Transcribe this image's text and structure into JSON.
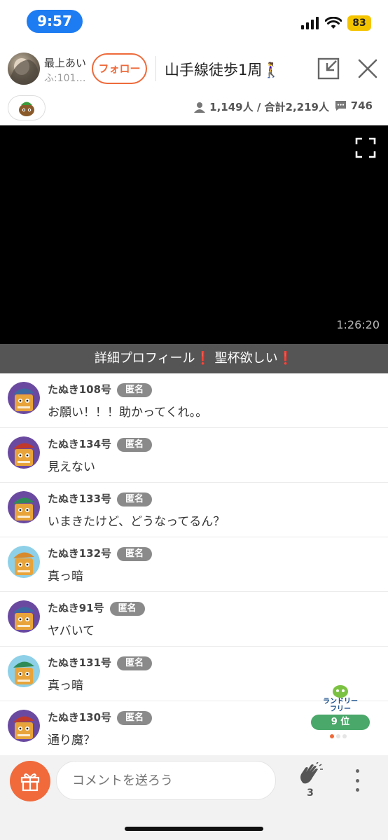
{
  "status_bar": {
    "time": "9:57",
    "battery": "83"
  },
  "header": {
    "host_name": "最上あい",
    "host_sub": "ふ:101…",
    "follow_label": "フォロー",
    "title": "山手線徒歩1周🚶‍♀️"
  },
  "stats": {
    "viewers": "1,149人 / 合計2,219人",
    "comments": "746"
  },
  "video": {
    "elapsed": "1:26:20"
  },
  "banner": {
    "text": "詳細プロフィール",
    "excl1": "❗",
    "text2": " 聖杯欲しい",
    "excl2": "❗"
  },
  "comments": [
    {
      "name": "たぬき108号",
      "badge": "匿名",
      "text": "お願い！！！助かってくれ。。",
      "hat": "#3b6aa0"
    },
    {
      "name": "たぬき134号",
      "badge": "匿名",
      "text": "見えない",
      "hat": "#c0392b"
    },
    {
      "name": "たぬき133号",
      "badge": "匿名",
      "text": "いまきたけど、どうなってるん？",
      "hat": "#2e8b57"
    },
    {
      "name": "たぬき132号",
      "badge": "匿名",
      "text": "真っ暗",
      "hat": "#d98a2b"
    },
    {
      "name": "たぬき91号",
      "badge": "匿名",
      "text": "ヤバいて",
      "hat": "#3b6aa0"
    },
    {
      "name": "たぬき131号",
      "badge": "匿名",
      "text": "真っ暗",
      "hat": "#2e8b57"
    },
    {
      "name": "たぬき130号",
      "badge": "匿名",
      "text": "通り魔？",
      "hat": "#c0392b"
    }
  ],
  "ranking": {
    "logo_text1": "ランドリー",
    "logo_text2": "フリー",
    "rank": "9 位"
  },
  "bottom": {
    "comment_placeholder": "コメントを送ろう",
    "clap_count": "3"
  },
  "colors": {
    "accent": "#ee6a3a",
    "badge_gray": "#8a8a8a",
    "banner": "#555555",
    "rank_green": "#4aa86a"
  }
}
